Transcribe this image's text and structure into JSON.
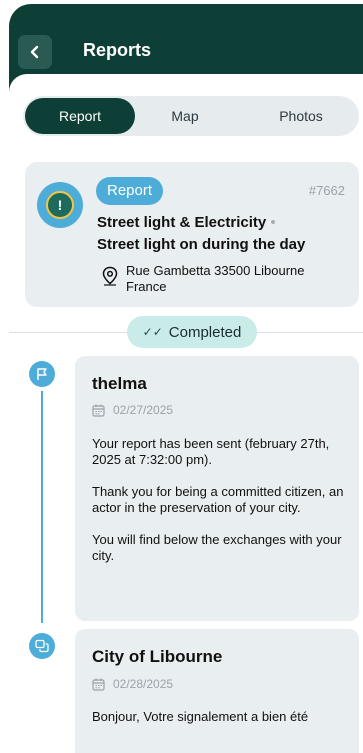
{
  "header": {
    "title": "Reports"
  },
  "tabs": [
    {
      "label": "Report",
      "active": true
    },
    {
      "label": "Map",
      "active": false
    },
    {
      "label": "Photos",
      "active": false
    }
  ],
  "report": {
    "type": "Report",
    "id": "#7662",
    "category": "Street light & Electricity",
    "subcategory": "Street light on during the day",
    "address": "Rue Gambetta 33500 Libourne France"
  },
  "status": {
    "label": "Completed"
  },
  "messages": [
    {
      "author": "thelma",
      "date": "02/27/2025",
      "paragraphs": [
        "Your report has been sent (february 27th, 2025 at 7:32:00 pm).",
        "Thank you for being a committed citizen, an actor in the preservation of your city.",
        "You will find below the exchanges with your city."
      ]
    },
    {
      "author": "City of Libourne",
      "date": "02/28/2025",
      "paragraphs": [
        "Bonjour, Votre signalement a bien été"
      ]
    }
  ],
  "colors": {
    "dark_green": "#0e3f36",
    "accent_blue": "#4dadd8",
    "badge_mint": "#c9ece9",
    "card_grey": "#e9eef1"
  }
}
